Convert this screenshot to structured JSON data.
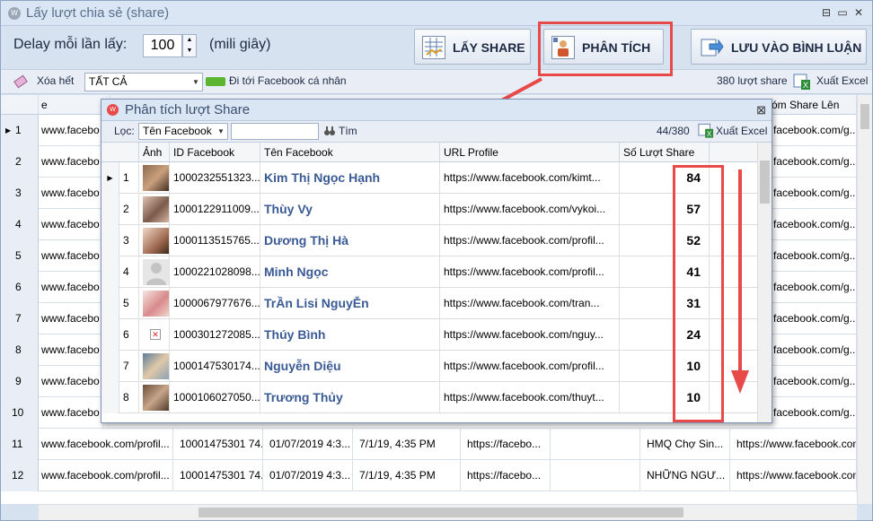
{
  "window": {
    "title": "Lấy lượt chia sẻ (share)",
    "icon_text": "W"
  },
  "window_controls": {
    "minimize": "⊟",
    "restore": "▭",
    "close": "✕"
  },
  "delay": {
    "label": "Delay mỗi lần lấy:",
    "value": "100",
    "unit": "(mili giây)"
  },
  "buttons": {
    "get_share": "LẤY SHARE",
    "analyze": "PHÂN TÍCH",
    "save_comment": "LƯU VÀO BÌNH LUẬN"
  },
  "toolbar": {
    "clear_all": "Xóa hết",
    "filter_value": "TẤT CẢ",
    "goto_facebook": "Đi tới Facebook cá nhân",
    "share_count": "380 lượt share",
    "export_excel": "Xuất Excel"
  },
  "background_grid": {
    "header_right": "óm Share Lên",
    "header_left": "e",
    "rows": [
      {
        "num": "1",
        "url": "www.facebo",
        "right": "facebook.com/g..."
      },
      {
        "num": "2",
        "url": "www.facebo",
        "right": "facebook.com/g..."
      },
      {
        "num": "3",
        "url": "www.facebo",
        "right": "facebook.com/g..."
      },
      {
        "num": "4",
        "url": "www.facebo",
        "right": "facebook.com/g..."
      },
      {
        "num": "5",
        "url": "www.facebo",
        "right": "facebook.com/g..."
      },
      {
        "num": "6",
        "url": "www.facebo",
        "right": "facebook.com/g..."
      },
      {
        "num": "7",
        "url": "www.facebo",
        "right": "facebook.com/g..."
      },
      {
        "num": "8",
        "url": "www.facebo",
        "right": "facebook.com/g..."
      },
      {
        "num": "9",
        "url": "www.facebo",
        "right": "facebook.com/g..."
      },
      {
        "num": "10",
        "url": "www.facebo",
        "right": "facebook.com/g..."
      }
    ],
    "full_rows": [
      {
        "num": "11",
        "url": "www.facebook.com/profil...",
        "id": "10001475301 74...",
        "date1": "01/07/2019 4:3...",
        "date2": "7/1/19, 4:35 PM",
        "link": "https://facebo...",
        "group": "HMQ Chợ Sin...",
        "right": "https://www.facebook.com/g..."
      },
      {
        "num": "12",
        "url": "www.facebook.com/profil...",
        "id": "10001475301 74...",
        "date1": "01/07/2019 4:3...",
        "date2": "7/1/19, 4:35 PM",
        "link": "https://facebo...",
        "group": "NHỮNG NGƯ...",
        "right": "https://www.facebook.com/g..."
      }
    ]
  },
  "popup": {
    "title": "Phân tích lượt Share",
    "filter_label": "Lọc:",
    "filter_field": "Tên Facebook",
    "search_label": "Tìm",
    "count": "44/380",
    "export_excel": "Xuất Excel",
    "columns": [
      "Ảnh",
      "ID Facebook",
      "Tên Facebook",
      "URL Profile",
      "Số Lượt Share"
    ],
    "rows": [
      {
        "num": "1",
        "id": "1000232551323...",
        "name": "Kim Thị Ngọc Hạnh",
        "url": "https://www.facebook.com/kimt...",
        "count": "84"
      },
      {
        "num": "2",
        "id": "1000122911009...",
        "name": "Thùy Vy",
        "url": "https://www.facebook.com/vykoi...",
        "count": "57"
      },
      {
        "num": "3",
        "id": "1000113515765...",
        "name": "Dương Thị Hà",
        "url": "https://www.facebook.com/profil...",
        "count": "52"
      },
      {
        "num": "4",
        "id": "1000221028098...",
        "name": "Minh Ngọc",
        "url": "https://www.facebook.com/profil...",
        "count": "41"
      },
      {
        "num": "5",
        "id": "1000067977676...",
        "name": "TrẦn Lisi NguyỄn",
        "url": "https://www.facebook.com/tran...",
        "count": "31"
      },
      {
        "num": "6",
        "id": "1000301272085...",
        "name": "Thúy Bình",
        "url": "https://www.facebook.com/nguy...",
        "count": "24"
      },
      {
        "num": "7",
        "id": "1000147530174...",
        "name": "Nguyễn Diệu",
        "url": "https://www.facebook.com/profil...",
        "count": "10"
      },
      {
        "num": "8",
        "id": "1000106027050...",
        "name": "Trương Thủy",
        "url": "https://www.facebook.com/thuyt...",
        "count": "10"
      }
    ]
  },
  "colors": {
    "highlight": "#e84a4a",
    "name_text": "#3a5a95"
  }
}
